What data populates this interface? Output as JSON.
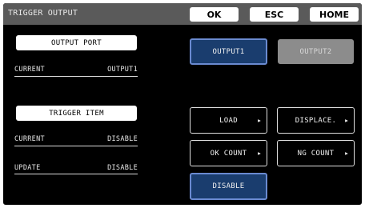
{
  "header": {
    "title": "TRIGGER OUTPUT",
    "ok_label": "OK",
    "esc_label": "ESC",
    "home_label": "HOME"
  },
  "output_port": {
    "section_label": "OUTPUT PORT",
    "current_label": "CURRENT",
    "current_value": "OUTPUT1",
    "options": [
      {
        "label": "OUTPUT1",
        "state": "selected"
      },
      {
        "label": "OUTPUT2",
        "state": "disabled"
      }
    ]
  },
  "trigger_item": {
    "section_label": "TRIGGER ITEM",
    "current_label": "CURRENT",
    "current_value": "DISABLE",
    "update_label": "UPDATE",
    "update_value": "DISABLE",
    "options": [
      {
        "label": "LOAD",
        "has_arrow": true
      },
      {
        "label": "DISPLACE.",
        "has_arrow": true
      },
      {
        "label": "OK COUNT",
        "has_arrow": true
      },
      {
        "label": "NG COUNT",
        "has_arrow": true
      },
      {
        "label": "DISABLE",
        "has_arrow": false,
        "state": "selected"
      }
    ]
  },
  "icons": {
    "arrow": "triangle-right-icon"
  },
  "colors": {
    "background": "#000000",
    "header": "#5a5a5a",
    "selected_fill": "#1a3d6e",
    "selected_border": "#6a8ad0",
    "disabled_fill": "#8c8c8c"
  }
}
